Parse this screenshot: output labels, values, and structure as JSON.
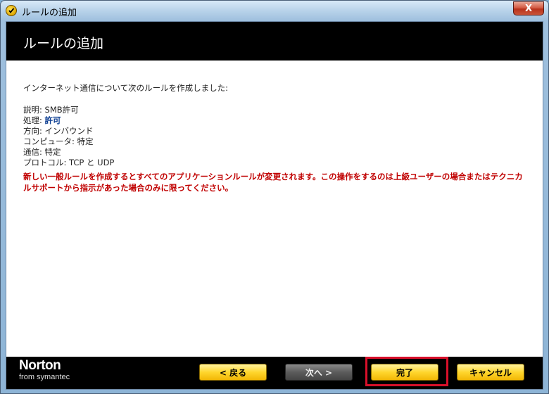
{
  "window": {
    "title": "ルールの追加",
    "close_label": "X"
  },
  "header": {
    "title": "ルールの追加"
  },
  "content": {
    "intro": "インターネット通信について次のルールを作成しました:",
    "details": [
      {
        "label": "説明: ",
        "value": "SMB許可"
      },
      {
        "label": "処理: ",
        "value": "許可"
      },
      {
        "label": "方向: ",
        "value": "インバウンド"
      },
      {
        "label": "コンピュータ: ",
        "value": "特定"
      },
      {
        "label": "通信: ",
        "value": "特定"
      },
      {
        "label": "プロトコル: ",
        "value": "TCP と UDP"
      }
    ],
    "warning": "新しい一般ルールを作成するとすべてのアプリケーションルールが変更されます。この操作をするのは上級ユーザーの場合またはテクニカルサポートから指示があった場合のみに限ってください。"
  },
  "footer": {
    "logo": {
      "name": "Norton",
      "sub": "from symantec"
    },
    "buttons": {
      "back": "< 戻る",
      "next": "次へ >",
      "finish": "完了",
      "cancel": "キャンセル"
    }
  },
  "colors": {
    "accent_red": "#c00000",
    "action_blue": "#0b3d91",
    "button_yellow": "#ffd62e"
  },
  "icons": {
    "app": "norton-shield-icon",
    "close": "close-icon"
  }
}
